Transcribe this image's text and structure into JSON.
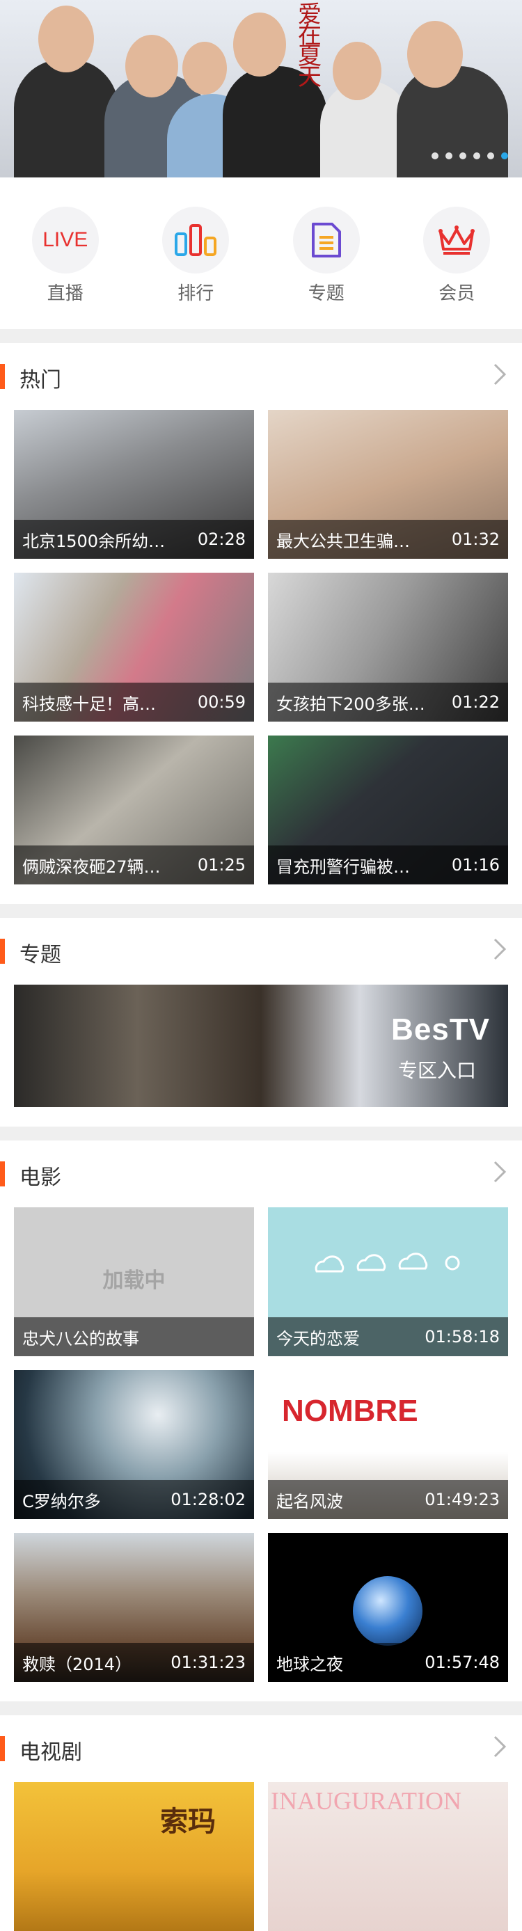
{
  "banner": {
    "title_art": "爱在夏天",
    "dots": 6,
    "active_dot": 5
  },
  "quick_nav": [
    {
      "label": "直播",
      "icon": "live-icon",
      "icon_text": "LIVE"
    },
    {
      "label": "排行",
      "icon": "ranking-bars-icon"
    },
    {
      "label": "专题",
      "icon": "topic-document-icon"
    },
    {
      "label": "会员",
      "icon": "crown-icon"
    }
  ],
  "hot": {
    "title": "热门",
    "items": [
      {
        "title": "北京1500余所幼…",
        "duration": "02:28"
      },
      {
        "title": "最大公共卫生骗…",
        "duration": "01:32"
      },
      {
        "title": "科技感十足！高…",
        "duration": "00:59"
      },
      {
        "title": "女孩拍下200多张…",
        "duration": "01:22"
      },
      {
        "title": "俩贼深夜砸27辆…",
        "duration": "01:25"
      },
      {
        "title": "冒充刑警行骗被…",
        "duration": "01:16"
      }
    ]
  },
  "topic": {
    "title": "专题",
    "banner_logo": "BesTV",
    "banner_sub": "专区入口"
  },
  "movies": {
    "title": "电影",
    "loading_text": "加载中",
    "items": [
      {
        "title": "忠犬八公的故事",
        "duration": ""
      },
      {
        "title": "今天的恋爱",
        "duration": "01:58:18"
      },
      {
        "title": "C罗纳尔多",
        "duration": "01:28:02"
      },
      {
        "title": "起名风波",
        "duration": "01:49:23"
      },
      {
        "title": "救赎（2014）",
        "duration": "01:31:23"
      },
      {
        "title": "地球之夜",
        "duration": "01:57:48"
      }
    ]
  },
  "tv": {
    "title": "电视剧",
    "poster_texts": [
      "索玛",
      "INAUGURATION"
    ]
  },
  "colors": {
    "accent": "#ff5b1a",
    "live_red": "#e8312f",
    "active_dot": "#2aa7e8"
  }
}
